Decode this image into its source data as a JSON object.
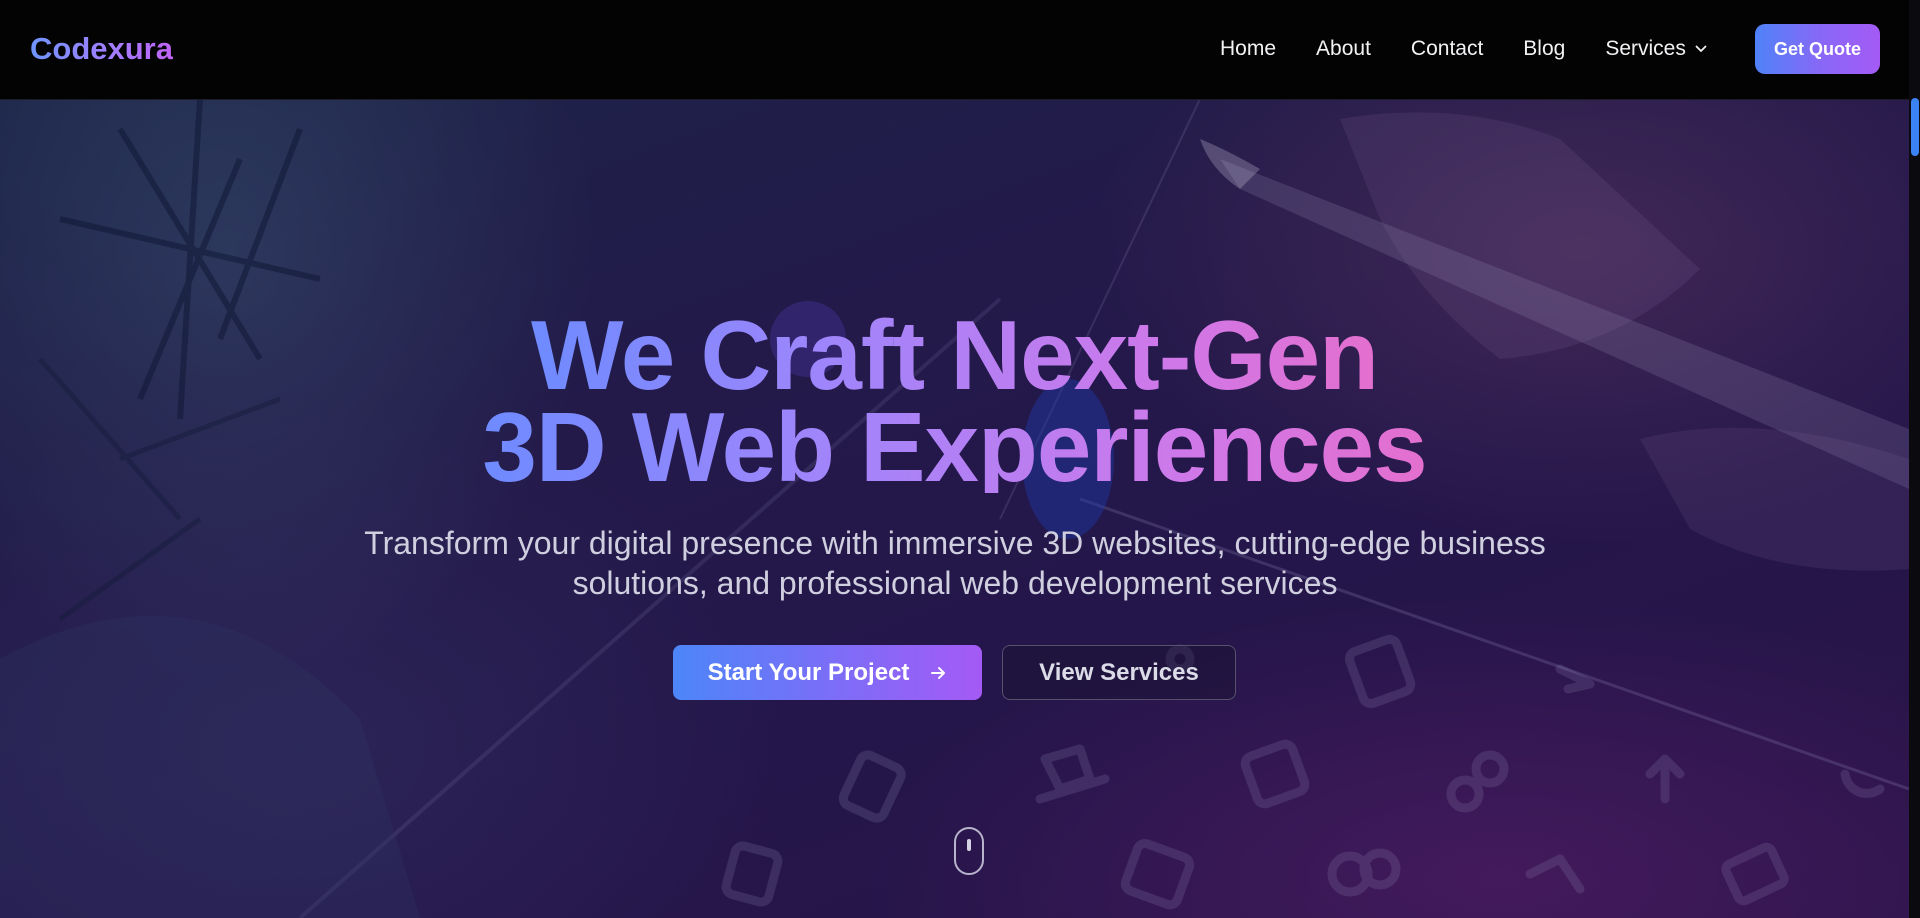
{
  "brand": {
    "name": "Codexura"
  },
  "nav": {
    "links": [
      "Home",
      "About",
      "Contact",
      "Blog"
    ],
    "services_label": "Services",
    "cta_label": "Get Quote"
  },
  "hero": {
    "title_line1": "We Craft Next-Gen",
    "title_line2": "3D Web Experiences",
    "subtitle_line1": "Transform your digital presence with immersive 3D websites, cutting-edge business",
    "subtitle_line2": "solutions, and professional web development services",
    "primary_cta": "Start Your Project",
    "secondary_cta": "View Services"
  },
  "icons": {
    "services_chevron": "chevron-down-icon",
    "primary_cta_icon": "arrow-right-icon",
    "scroll": "mouse-scroll-icon"
  },
  "colors": {
    "accent_blue": "#4f82f8",
    "accent_purple": "#a45af5",
    "title_pink": "#e46fce",
    "navbar_bg": "#030303"
  }
}
